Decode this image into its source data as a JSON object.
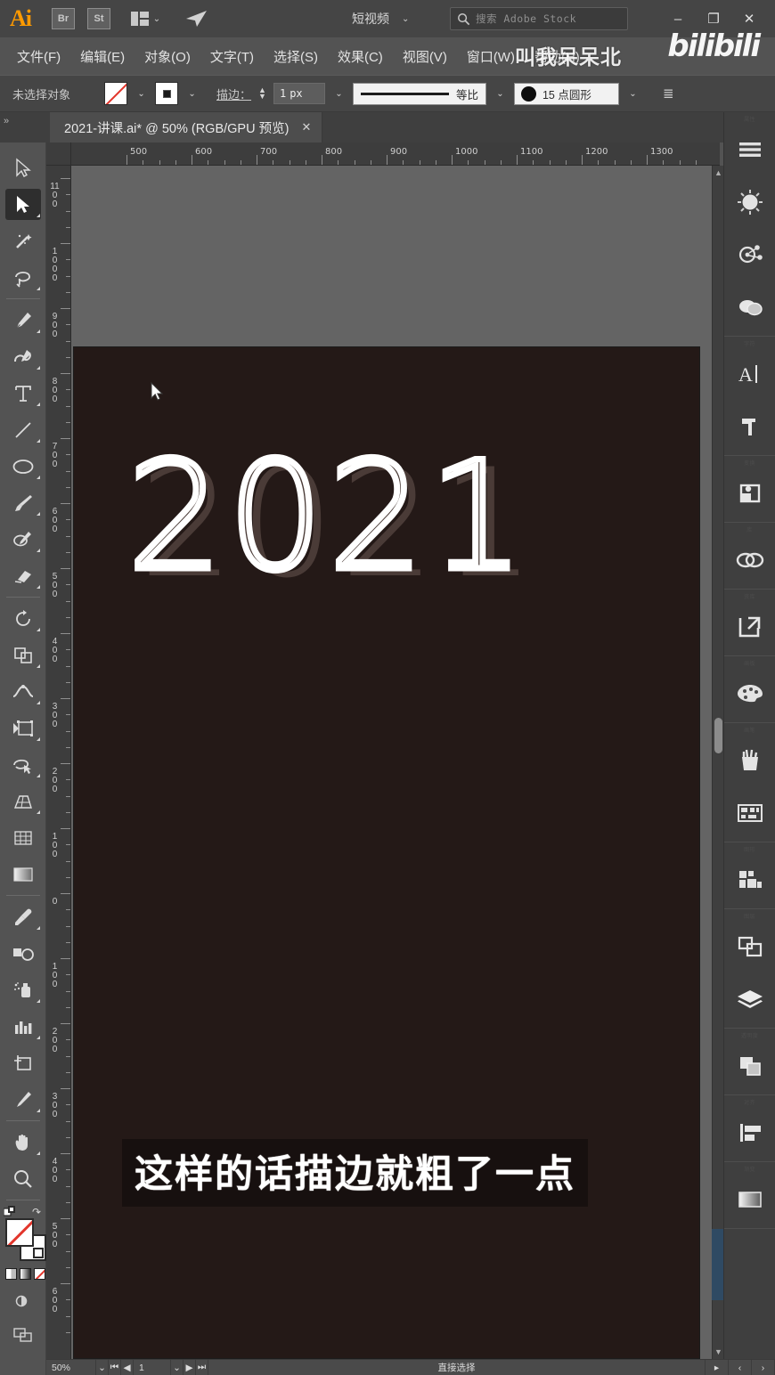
{
  "app": {
    "name": "Ai",
    "logo_text": "Ai"
  },
  "titlebar": {
    "bridge_label": "Br",
    "stock_label": "St",
    "arrange_icon": "arrange-documents-icon",
    "arrange_caret": "⌄",
    "share_icon": "share-icon",
    "workspace_label": "短视频",
    "workspace_caret": "⌄",
    "search_icon": "search-icon",
    "search_placeholder": "搜索 Adobe Stock",
    "minimize": "–",
    "maximize": "❐",
    "close": "✕"
  },
  "menubar": {
    "items": [
      {
        "label": "文件(F)"
      },
      {
        "label": "编辑(E)"
      },
      {
        "label": "对象(O)"
      },
      {
        "label": "文字(T)"
      },
      {
        "label": "选择(S)"
      },
      {
        "label": "效果(C)"
      },
      {
        "label": "视图(V)"
      },
      {
        "label": "窗口(W)"
      },
      {
        "label": "帮助(H)"
      }
    ]
  },
  "watermark": {
    "author": "叫我呆呆北",
    "site": "bilibili"
  },
  "controlbar": {
    "selection_status": "未选择对象",
    "fill_swatch": "none-fill-swatch",
    "fill_caret": "⌄",
    "stroke_swatch": "stroke-swatch",
    "stroke_caret": "⌄",
    "stroke_label": "描边：",
    "stroke_weight": "1",
    "stroke_unit": "px",
    "stroke_caret2": "⌄",
    "profile_label": "等比",
    "profile_caret": "⌄",
    "brush_label": "15 点圆形",
    "brush_caret": "⌄",
    "options_icon": "options-list-icon"
  },
  "tabstrip": {
    "collapse_left_icon": "collapse-left-icon",
    "collapse_right_icon": "collapse-right-icon",
    "document_tab": "2021-讲课.ai* @ 50% (RGB/GPU 预览)",
    "close_tab": "✕"
  },
  "left_toolbar": {
    "tools": [
      {
        "name": "selection-tool",
        "selected": false
      },
      {
        "name": "direct-selection-tool",
        "selected": true
      },
      {
        "name": "magic-wand-tool",
        "selected": false
      },
      {
        "name": "lasso-tool",
        "selected": false
      },
      {
        "name": "pen-tool",
        "selected": false
      },
      {
        "name": "curvature-tool",
        "selected": false
      },
      {
        "name": "type-tool",
        "selected": false
      },
      {
        "name": "line-segment-tool",
        "selected": false
      },
      {
        "name": "ellipse-tool",
        "selected": false
      },
      {
        "name": "paintbrush-tool",
        "selected": false
      },
      {
        "name": "shaper-tool",
        "selected": false
      },
      {
        "name": "eraser-tool",
        "selected": false
      },
      {
        "name": "rotate-tool",
        "selected": false
      },
      {
        "name": "scale-tool",
        "selected": false
      },
      {
        "name": "width-tool",
        "selected": false
      },
      {
        "name": "free-transform-tool",
        "selected": false
      },
      {
        "name": "shape-builder-tool",
        "selected": false
      },
      {
        "name": "perspective-grid-tool",
        "selected": false
      },
      {
        "name": "mesh-tool",
        "selected": false
      },
      {
        "name": "gradient-tool",
        "selected": false
      },
      {
        "name": "eyedropper-tool",
        "selected": false
      },
      {
        "name": "blend-tool",
        "selected": false
      },
      {
        "name": "symbol-sprayer-tool",
        "selected": false
      },
      {
        "name": "column-graph-tool",
        "selected": false
      },
      {
        "name": "artboard-tool",
        "selected": false
      },
      {
        "name": "slice-tool",
        "selected": false
      },
      {
        "name": "hand-tool",
        "selected": false
      },
      {
        "name": "zoom-tool",
        "selected": false
      }
    ],
    "fill_stroke": {
      "fill_name": "fill-swatch-none",
      "stroke_name": "stroke-swatch-white",
      "swap_icon": "swap-fill-stroke-icon",
      "default_icon": "default-fill-stroke-icon",
      "color_mode": "color-swatch",
      "gradient_mode": "gradient-swatch",
      "none_mode": "none-swatch"
    },
    "bottom": {
      "drawing_mode_icon": "drawing-mode-icon",
      "screen_mode_icon": "screen-mode-icon"
    }
  },
  "right_dock": {
    "groups": [
      {
        "label": "属性",
        "buttons": [
          {
            "name": "properties-panel-icon"
          },
          {
            "name": "color-wheel-panel-icon"
          },
          {
            "name": "color-guide-panel-icon"
          },
          {
            "name": "swatches-panel-icon"
          }
        ]
      },
      {
        "label": "字符",
        "buttons": [
          {
            "name": "character-panel-icon"
          },
          {
            "name": "paragraph-panel-icon"
          }
        ]
      },
      {
        "label": "变换",
        "buttons": [
          {
            "name": "transform-panel-icon"
          }
        ]
      },
      {
        "label": "库",
        "buttons": [
          {
            "name": "cc-libraries-panel-icon"
          }
        ]
      },
      {
        "label": "资库",
        "buttons": [
          {
            "name": "export-panel-icon"
          }
        ]
      },
      {
        "label": "画板",
        "buttons": [
          {
            "name": "artboards-panel-icon"
          }
        ]
      },
      {
        "label": "画笔",
        "buttons": [
          {
            "name": "brushes-panel-icon"
          },
          {
            "name": "symbols-panel-icon"
          }
        ]
      },
      {
        "label": "图形",
        "buttons": [
          {
            "name": "graphic-styles-panel-icon"
          }
        ]
      },
      {
        "label": "图层",
        "buttons": [
          {
            "name": "pathfinder-panel-icon"
          },
          {
            "name": "layers-panel-icon"
          }
        ]
      },
      {
        "label": "透明度",
        "buttons": [
          {
            "name": "transparency-panel-icon"
          }
        ]
      },
      {
        "label": "对齐",
        "buttons": [
          {
            "name": "align-panel-icon"
          }
        ]
      },
      {
        "label": "渐变",
        "buttons": [
          {
            "name": "gradient-panel-icon"
          }
        ]
      }
    ]
  },
  "rulers": {
    "horizontal": [
      "500",
      "600",
      "700",
      "800",
      "900",
      "1000",
      "1100",
      "1200",
      "1300"
    ],
    "vertical": [
      "1100",
      "1000",
      "900",
      "800",
      "700",
      "600",
      "500",
      "400",
      "300",
      "200",
      "100",
      "0",
      "100",
      "200",
      "300",
      "400",
      "500",
      "600"
    ]
  },
  "canvas": {
    "artboard_color": "#241917",
    "headline": "2021",
    "headline_stroke_color": "#ffffff",
    "headline_fill_color": "#4a3b37",
    "subtitle": "这样的话描边就粗了一点",
    "subtitle_bg": "#17100f",
    "cursor_icon": "mouse-cursor-arrow"
  },
  "statusbar": {
    "zoom": "50%",
    "zoom_caret": "⌄",
    "first_page": "⏮",
    "prev_page": "◀",
    "page": "1",
    "page_caret": "⌄",
    "next_page": "▶",
    "last_page": "⏭",
    "status_text": "直接选择",
    "status_caret": "▸",
    "nav_prev": "‹",
    "nav_next": "›"
  }
}
